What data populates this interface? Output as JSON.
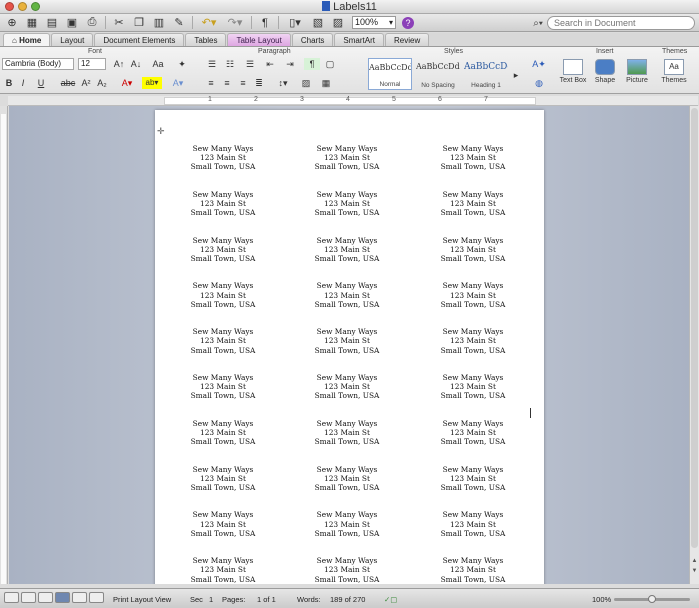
{
  "window": {
    "title": "Labels11"
  },
  "toolbar": {
    "zoom": "100%",
    "search_placeholder": "Search in Document",
    "icons": [
      "new-icon",
      "templates-icon",
      "open-icon",
      "save-icon",
      "print-icon",
      "cut-icon",
      "copy-icon",
      "paste-icon",
      "format-painter-icon",
      "undo-icon",
      "redo-icon",
      "paragraph-mark-icon",
      "sidebar-icon",
      "toolbox-icon",
      "media-icon",
      "help-icon"
    ]
  },
  "tabs": [
    {
      "label": "Home",
      "active": true
    },
    {
      "label": "Layout"
    },
    {
      "label": "Document Elements"
    },
    {
      "label": "Tables"
    },
    {
      "label": "Table Layout",
      "contextual": true
    },
    {
      "label": "Charts"
    },
    {
      "label": "SmartArt"
    },
    {
      "label": "Review"
    }
  ],
  "ribbon": {
    "groups": {
      "font": "Font",
      "paragraph": "Paragraph",
      "styles": "Styles",
      "insert": "Insert",
      "themes": "Themes"
    },
    "font_name": "Cambria (Body)",
    "font_size": "12",
    "styles": [
      {
        "sample": "AaBbCcDdEe",
        "name": "Normal",
        "selected": true
      },
      {
        "sample": "AaBbCcDdEe",
        "name": "No Spacing"
      },
      {
        "sample": "AaBbCcDc",
        "name": "Heading 1",
        "accent": "#2c5aa0"
      }
    ],
    "insert_items": [
      {
        "label": "Text Box"
      },
      {
        "label": "Shape"
      },
      {
        "label": "Picture"
      }
    ],
    "themes_label": "Themes",
    "themes_sample": "Aa"
  },
  "ruler": {
    "numbers": [
      "1",
      "2",
      "3",
      "4",
      "5",
      "6",
      "7"
    ]
  },
  "document": {
    "label": {
      "line1": "Sew Many Ways",
      "line2": "123 Main St",
      "line3": "Small Town, USA"
    },
    "rows": 10,
    "cols": 3
  },
  "status": {
    "view": "Print Layout View",
    "sec_label": "Sec",
    "sec_value": "1",
    "pages_label": "Pages:",
    "pages_value": "1 of 1",
    "words_label": "Words:",
    "words_value": "189 of 270",
    "zoom": "100%"
  },
  "colors": {
    "accent": "#2b5bb8",
    "contextual_tab": "#dea6e2",
    "workspace": "#c3c9d5"
  }
}
